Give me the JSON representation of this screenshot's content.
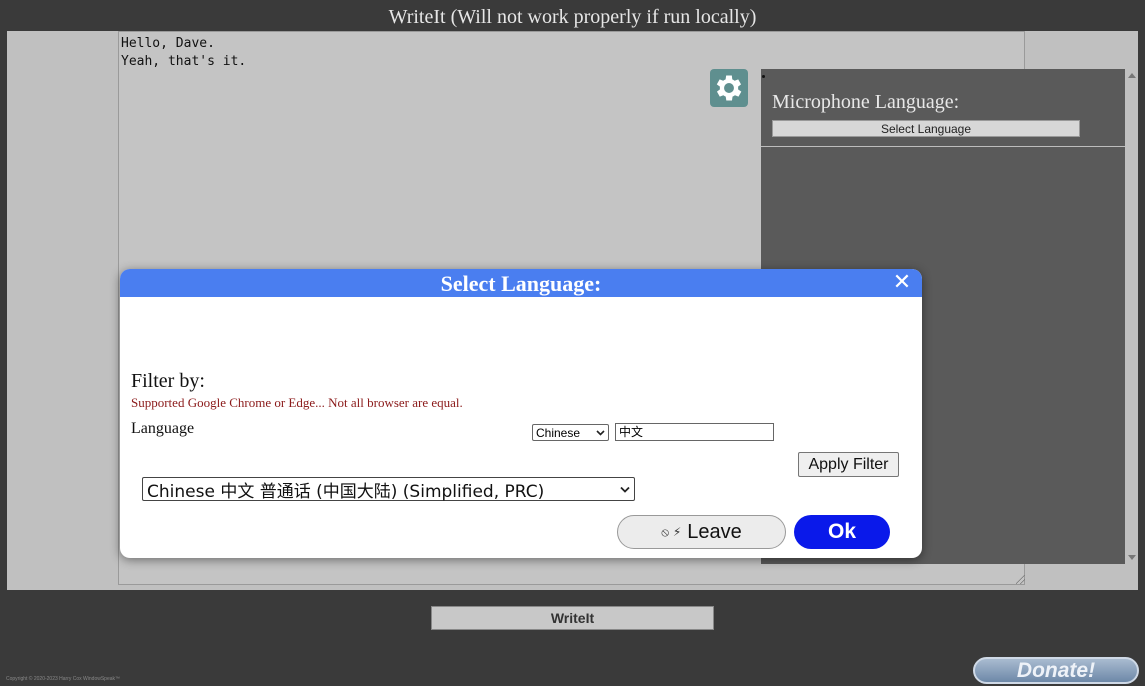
{
  "app": {
    "title": "WriteIt (Will not work properly if run locally)"
  },
  "editor": {
    "lines": "Hello, Dave.\nYeah, that's it."
  },
  "settings": {
    "icon": "gear-icon"
  },
  "side_panel": {
    "mic_label": "Microphone Language:",
    "select_button": "Select Language"
  },
  "modal": {
    "title": "Select Language:",
    "close_symbol": "✕",
    "filter_label": "Filter by:",
    "note": "Supported Google Chrome or Edge... Not all browser are equal.",
    "language_label": "Language",
    "filter_select_value": "Chinese",
    "filter_input_value": "中文",
    "apply_button": "Apply Filter",
    "language_select_value": "Chinese 中文 普通话 (中国大陆) (Simplified, PRC)",
    "leave_icons": "⦸ ⚡",
    "leave_button": "Leave",
    "ok_button": "Ok"
  },
  "footer": {
    "writeit_button": "WriteIt",
    "copyright": "Copyright © 2020-2023 Harry Cox WindowSpeak™",
    "donate_button": "Donate!"
  },
  "colors": {
    "modal_header": "#4a7ef0",
    "ok_button": "#0a19ea",
    "note_text": "#8b1a1a"
  }
}
